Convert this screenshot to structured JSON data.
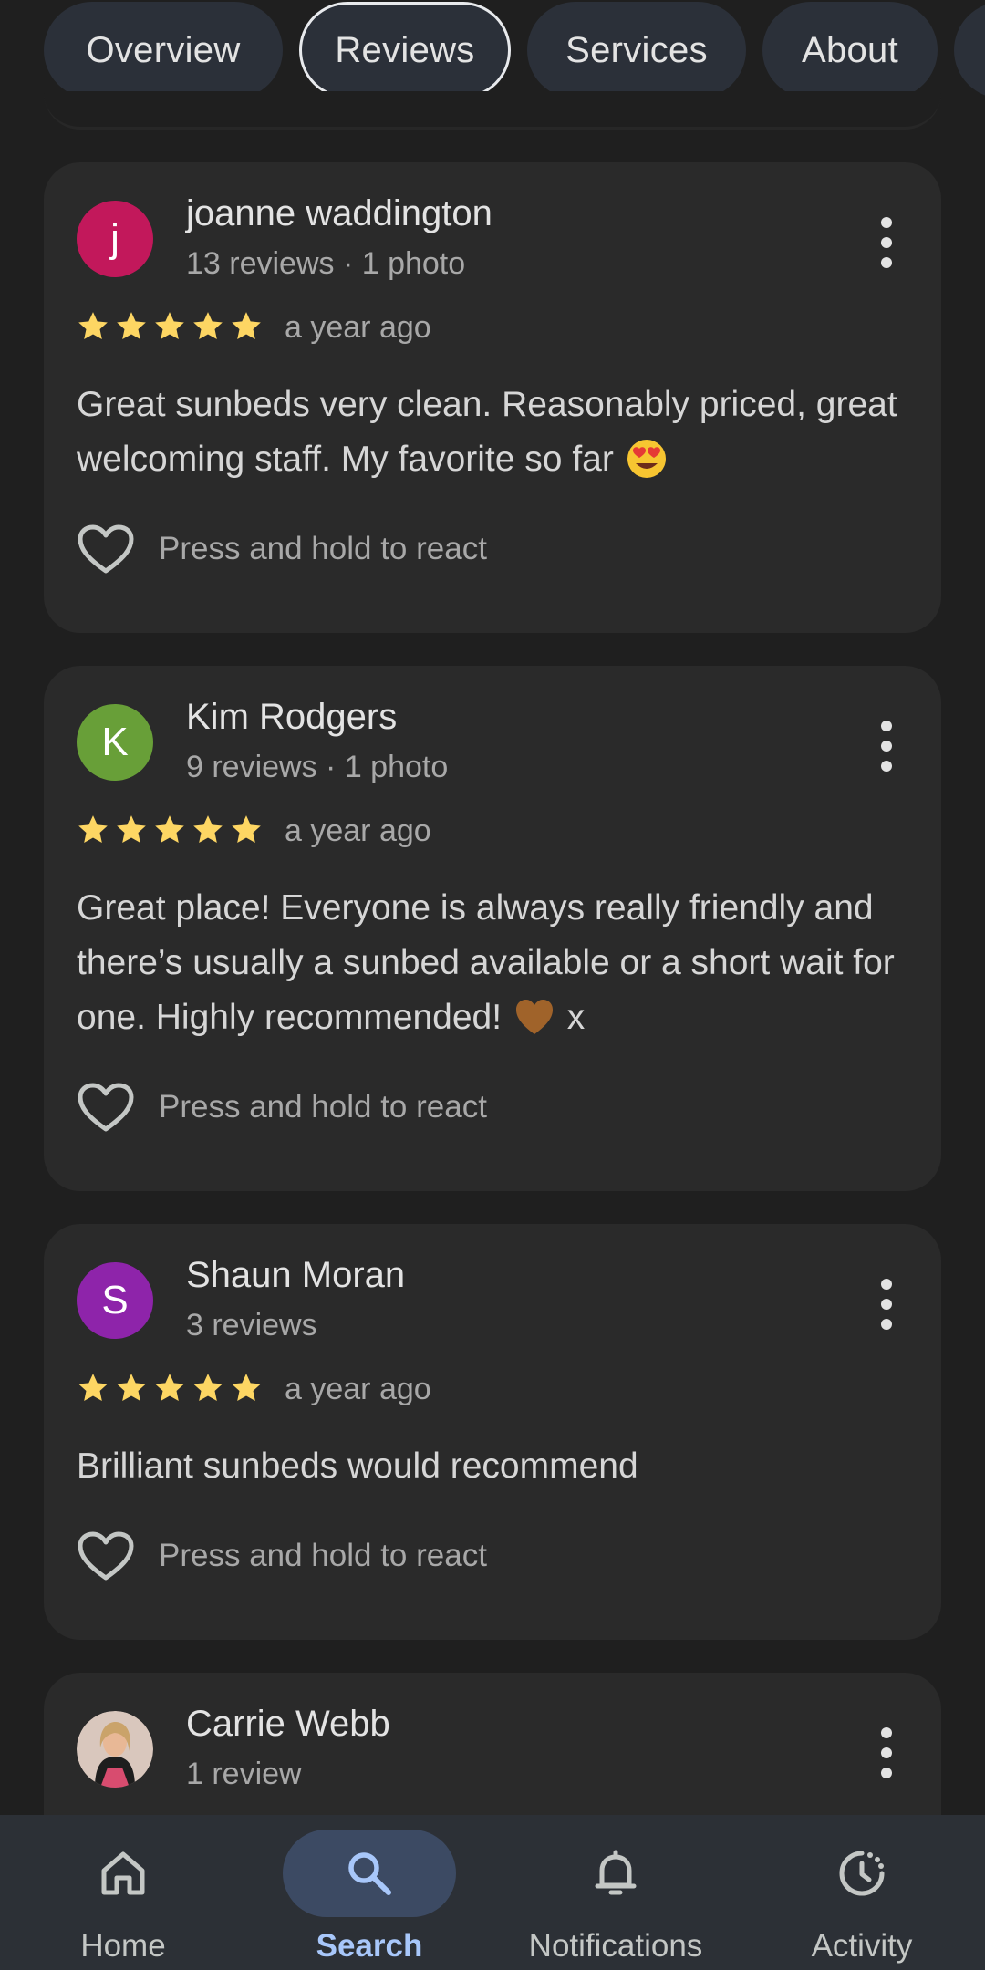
{
  "tabs": [
    {
      "label": "Overview",
      "active": false
    },
    {
      "label": "Reviews",
      "active": true
    },
    {
      "label": "Services",
      "active": false
    },
    {
      "label": "About",
      "active": false
    }
  ],
  "colors": {
    "background": "#1f1f1f",
    "card": "#2a2a2a",
    "star": "#fdd663",
    "nav_active_pill": "#3c4a63",
    "nav_active_text": "#a8c7fa"
  },
  "reviews": [
    {
      "avatar_letter": "j",
      "avatar_color": "#c2185b",
      "name": "joanne waddington",
      "meta": "13 reviews · 1 photo",
      "rating": 5,
      "time": "a year ago",
      "text": "Great sunbeds very clean. Reasonably priced, great welcoming staff. My favorite so far",
      "emoji": "heart-eyes-emoji",
      "react_label": "Press and hold to react"
    },
    {
      "avatar_letter": "K",
      "avatar_color": "#689f38",
      "name": "Kim Rodgers",
      "meta": "9 reviews · 1 photo",
      "rating": 5,
      "time": "a year ago",
      "text": "Great place! Everyone is always really friendly and there’s usually a sunbed available or a short wait for one. Highly recommended!",
      "text_suffix": "x",
      "emoji": "brown-heart-emoji",
      "react_label": "Press and hold to react"
    },
    {
      "avatar_letter": "S",
      "avatar_color": "#8e24aa",
      "name": "Shaun Moran",
      "meta": "3 reviews",
      "rating": 5,
      "time": "a year ago",
      "text": "Brilliant sunbeds would recommend",
      "react_label": "Press and hold to react"
    },
    {
      "avatar_letter": "",
      "avatar_color": "#8a6a5c",
      "name": "Carrie Webb",
      "meta": "1 review"
    }
  ],
  "bottom_nav": [
    {
      "label": "Home",
      "icon": "home-icon",
      "active": false
    },
    {
      "label": "Search",
      "icon": "search-icon",
      "active": true
    },
    {
      "label": "Notifications",
      "icon": "bell-icon",
      "active": false
    },
    {
      "label": "Activity",
      "icon": "activity-icon",
      "active": false
    }
  ]
}
